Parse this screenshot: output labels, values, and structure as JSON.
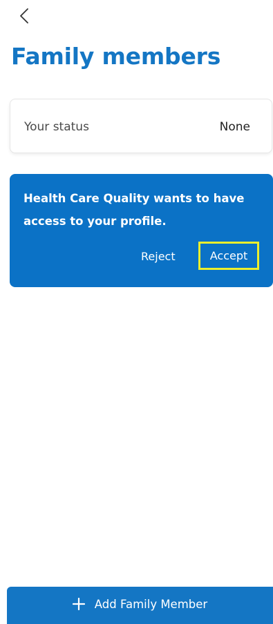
{
  "header": {
    "back_icon": "chevron-left-icon",
    "title": "Family members"
  },
  "status": {
    "label": "Your status",
    "value": "None"
  },
  "request": {
    "message": "Health Care Quality wants to have access to your profile.",
    "reject_label": "Reject",
    "accept_label": "Accept"
  },
  "footer": {
    "add_icon": "plus-icon",
    "add_label": "Add Family Member"
  },
  "colors": {
    "accent": "#1476c4",
    "card_blue": "#0b72c6",
    "highlight": "#ecef2c",
    "background": "#ffffff"
  }
}
